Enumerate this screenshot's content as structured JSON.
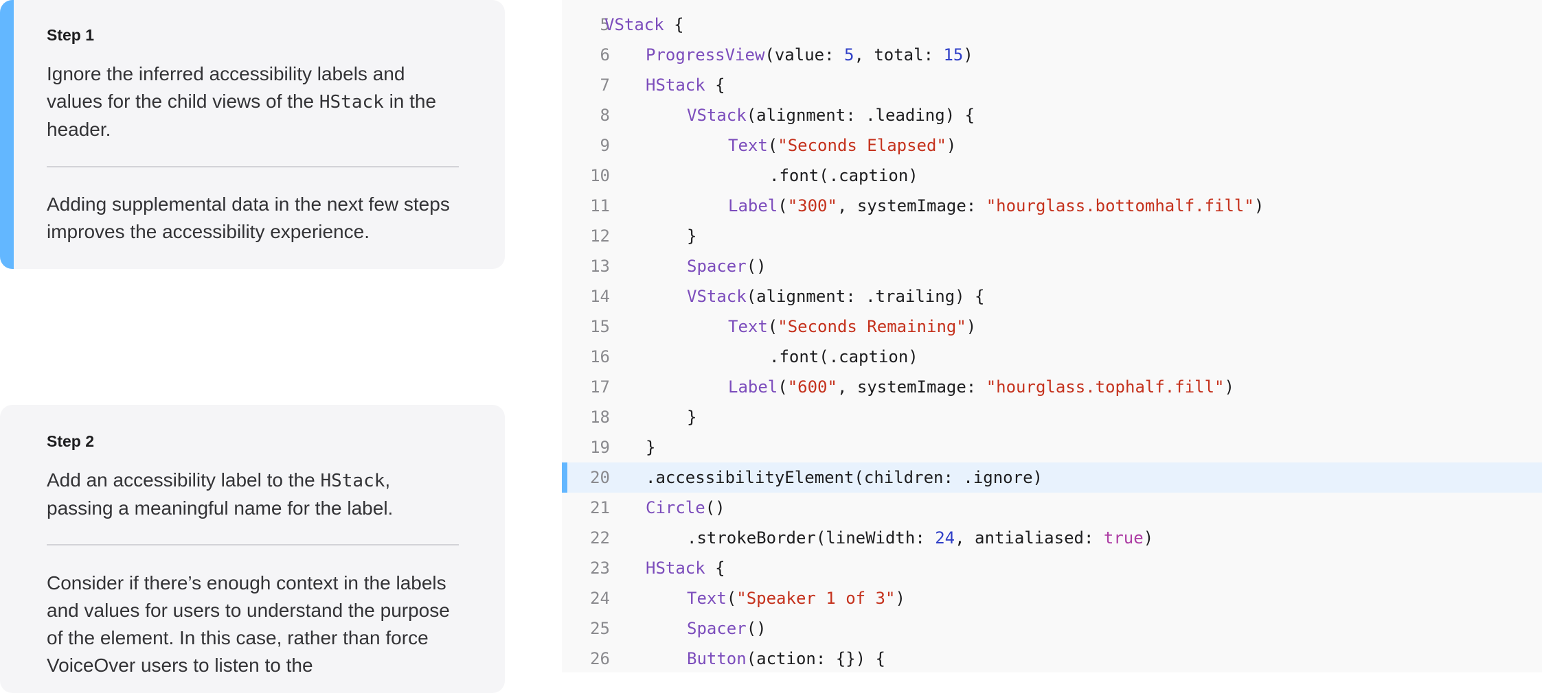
{
  "steps": [
    {
      "title": "Step 1",
      "body_pre": "Ignore the inferred accessibility labels and values for the child views of the ",
      "body_code": "HStack",
      "body_post": " in the header.",
      "note": "Adding supplemental data in the next few steps improves the accessibility experience."
    },
    {
      "title": "Step 2",
      "body_pre": "Add an accessibility label to the ",
      "body_code": "HStack",
      "body_post": ", passing a meaningful name for the label.",
      "note": "Consider if there’s enough context in the labels and values for users to understand the purpose of the element. In this case, rather than force VoiceOver users to listen to the"
    }
  ],
  "code": {
    "highlighted_line": 20,
    "lines": [
      {
        "n": "5",
        "indent": 2,
        "tokens": [
          {
            "t": "VStack",
            "c": "type"
          },
          {
            "t": " {",
            "c": "plain"
          }
        ]
      },
      {
        "n": "6",
        "indent": 3,
        "tokens": [
          {
            "t": "ProgressView",
            "c": "type"
          },
          {
            "t": "(value: ",
            "c": "plain"
          },
          {
            "t": "5",
            "c": "num"
          },
          {
            "t": ", total: ",
            "c": "plain"
          },
          {
            "t": "15",
            "c": "num"
          },
          {
            "t": ")",
            "c": "plain"
          }
        ]
      },
      {
        "n": "7",
        "indent": 3,
        "tokens": [
          {
            "t": "HStack",
            "c": "type"
          },
          {
            "t": " {",
            "c": "plain"
          }
        ]
      },
      {
        "n": "8",
        "indent": 4,
        "tokens": [
          {
            "t": "VStack",
            "c": "type"
          },
          {
            "t": "(alignment: .leading) {",
            "c": "plain"
          }
        ]
      },
      {
        "n": "9",
        "indent": 5,
        "tokens": [
          {
            "t": "Text",
            "c": "type"
          },
          {
            "t": "(",
            "c": "plain"
          },
          {
            "t": "\"Seconds Elapsed\"",
            "c": "str"
          },
          {
            "t": ")",
            "c": "plain"
          }
        ]
      },
      {
        "n": "10",
        "indent": 6,
        "tokens": [
          {
            "t": ".font(.caption)",
            "c": "plain"
          }
        ]
      },
      {
        "n": "11",
        "indent": 5,
        "tokens": [
          {
            "t": "Label",
            "c": "type"
          },
          {
            "t": "(",
            "c": "plain"
          },
          {
            "t": "\"300\"",
            "c": "str"
          },
          {
            "t": ", systemImage: ",
            "c": "plain"
          },
          {
            "t": "\"hourglass.bottomhalf.fill\"",
            "c": "str"
          },
          {
            "t": ")",
            "c": "plain"
          }
        ]
      },
      {
        "n": "12",
        "indent": 4,
        "tokens": [
          {
            "t": "}",
            "c": "plain"
          }
        ]
      },
      {
        "n": "13",
        "indent": 4,
        "tokens": [
          {
            "t": "Spacer",
            "c": "type"
          },
          {
            "t": "()",
            "c": "plain"
          }
        ]
      },
      {
        "n": "14",
        "indent": 4,
        "tokens": [
          {
            "t": "VStack",
            "c": "type"
          },
          {
            "t": "(alignment: .trailing) {",
            "c": "plain"
          }
        ]
      },
      {
        "n": "15",
        "indent": 5,
        "tokens": [
          {
            "t": "Text",
            "c": "type"
          },
          {
            "t": "(",
            "c": "plain"
          },
          {
            "t": "\"Seconds Remaining\"",
            "c": "str"
          },
          {
            "t": ")",
            "c": "plain"
          }
        ]
      },
      {
        "n": "16",
        "indent": 6,
        "tokens": [
          {
            "t": ".font(.caption)",
            "c": "plain"
          }
        ]
      },
      {
        "n": "17",
        "indent": 5,
        "tokens": [
          {
            "t": "Label",
            "c": "type"
          },
          {
            "t": "(",
            "c": "plain"
          },
          {
            "t": "\"600\"",
            "c": "str"
          },
          {
            "t": ", systemImage: ",
            "c": "plain"
          },
          {
            "t": "\"hourglass.tophalf.fill\"",
            "c": "str"
          },
          {
            "t": ")",
            "c": "plain"
          }
        ]
      },
      {
        "n": "18",
        "indent": 4,
        "tokens": [
          {
            "t": "}",
            "c": "plain"
          }
        ]
      },
      {
        "n": "19",
        "indent": 3,
        "tokens": [
          {
            "t": "}",
            "c": "plain"
          }
        ]
      },
      {
        "n": "20",
        "indent": 3,
        "tokens": [
          {
            "t": ".accessibilityElement(children: .ignore)",
            "c": "plain"
          }
        ]
      },
      {
        "n": "21",
        "indent": 3,
        "tokens": [
          {
            "t": "Circle",
            "c": "type"
          },
          {
            "t": "()",
            "c": "plain"
          }
        ]
      },
      {
        "n": "22",
        "indent": 4,
        "tokens": [
          {
            "t": ".strokeBorder(lineWidth: ",
            "c": "plain"
          },
          {
            "t": "24",
            "c": "num"
          },
          {
            "t": ", antialiased: ",
            "c": "plain"
          },
          {
            "t": "true",
            "c": "kw"
          },
          {
            "t": ")",
            "c": "plain"
          }
        ]
      },
      {
        "n": "23",
        "indent": 3,
        "tokens": [
          {
            "t": "HStack",
            "c": "type"
          },
          {
            "t": " {",
            "c": "plain"
          }
        ]
      },
      {
        "n": "24",
        "indent": 4,
        "tokens": [
          {
            "t": "Text",
            "c": "type"
          },
          {
            "t": "(",
            "c": "plain"
          },
          {
            "t": "\"Speaker 1 of 3\"",
            "c": "str"
          },
          {
            "t": ")",
            "c": "plain"
          }
        ]
      },
      {
        "n": "25",
        "indent": 4,
        "tokens": [
          {
            "t": "Spacer",
            "c": "type"
          },
          {
            "t": "()",
            "c": "plain"
          }
        ]
      },
      {
        "n": "26",
        "indent": 4,
        "tokens": [
          {
            "t": "Button",
            "c": "type"
          },
          {
            "t": "(action: {}) {",
            "c": "plain"
          }
        ]
      }
    ]
  },
  "colors": {
    "accent": "#63b7ff",
    "type": "#7c4dbc",
    "string": "#c5321d",
    "number": "#2f3fc7",
    "keyword": "#ad3da4",
    "highlight_bg": "#e8f2fd"
  }
}
